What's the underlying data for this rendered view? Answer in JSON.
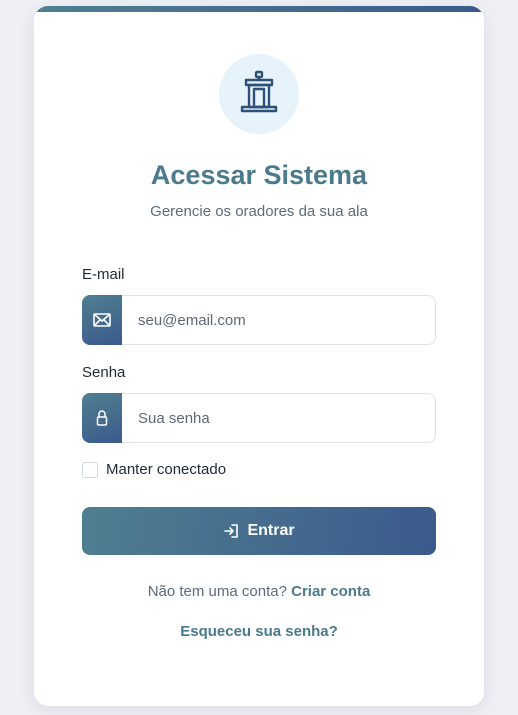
{
  "header": {
    "title": "Acessar Sistema",
    "subtitle": "Gerencie os oradores da sua ala",
    "logo_icon": "podium-icon"
  },
  "form": {
    "email": {
      "label": "E-mail",
      "placeholder": "seu@email.com",
      "value": "",
      "icon": "envelope-icon"
    },
    "password": {
      "label": "Senha",
      "placeholder": "Sua senha",
      "value": "",
      "icon": "lock-icon"
    },
    "remember": {
      "label": "Manter conectado",
      "checked": false
    },
    "submit": {
      "label": "Entrar",
      "icon": "sign-in-icon"
    }
  },
  "footer": {
    "signup_prompt": "Não tem uma conta?",
    "signup_link": "Criar conta",
    "forgot_link": "Esqueceu sua senha?"
  },
  "colors": {
    "accent": "#4a7a8c",
    "gradient_start": "#4f7f90",
    "gradient_end": "#3b5a8c",
    "logo_bg": "#e6f3fb"
  }
}
